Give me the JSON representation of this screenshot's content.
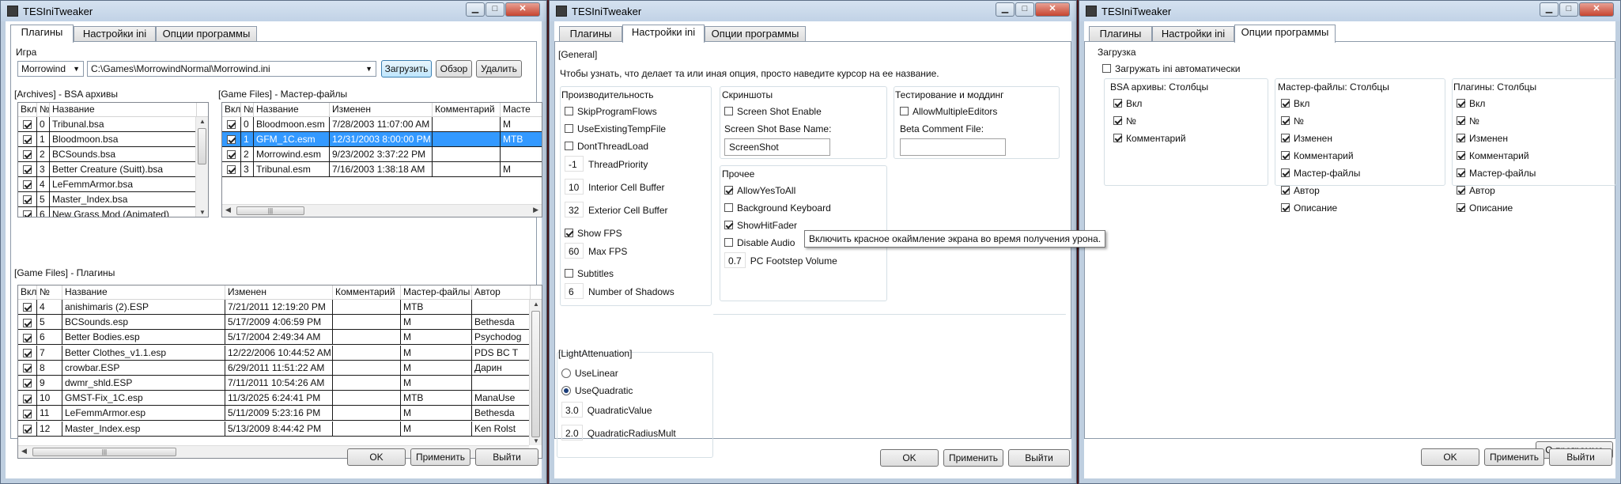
{
  "windows": [
    {
      "title": "TESIniTweaker",
      "tabs": [
        "Плагины",
        "Настройки ini",
        "Опции программы"
      ],
      "active_tab": 0
    },
    {
      "title": "TESIniTweaker",
      "tabs": [
        "Плагины",
        "Настройки ini",
        "Опции программы"
      ],
      "active_tab": 1
    },
    {
      "title": "TESIniTweaker",
      "tabs": [
        "Плагины",
        "Настройки ini",
        "Опции программы"
      ],
      "active_tab": 2
    }
  ],
  "window_buttons": {
    "minimize": "▁",
    "maximize": "□",
    "close": "✕"
  },
  "footer": {
    "ok": "OK",
    "apply": "Применить",
    "exit": "Выйти"
  },
  "plugins": {
    "game_label": "Игра",
    "game_value": "Morrowind",
    "path_value": "C:\\Games\\MorrowindNormal\\Morrowind.ini",
    "load_btn": "Загрузить",
    "browse_btn": "Обзор",
    "delete_btn": "Удалить",
    "bsa_title": "[Archives] - BSA архивы",
    "bsa_headers": [
      "Вкл",
      "№",
      "Название"
    ],
    "bsa_rows": [
      {
        "on": true,
        "n": "0",
        "name": "Tribunal.bsa"
      },
      {
        "on": true,
        "n": "1",
        "name": "Bloodmoon.bsa"
      },
      {
        "on": true,
        "n": "2",
        "name": "BCSounds.bsa"
      },
      {
        "on": true,
        "n": "3",
        "name": "Better Creature (Suitt).bsa"
      },
      {
        "on": true,
        "n": "4",
        "name": "LeFemmArmor.bsa"
      },
      {
        "on": true,
        "n": "5",
        "name": "Master_Index.bsa"
      },
      {
        "on": true,
        "n": "6",
        "name": "New Grass Mod (Animated)"
      }
    ],
    "master_title": "[Game Files] - Мастер-файлы",
    "master_headers": [
      "Вкл",
      "№",
      "Название",
      "Изменен",
      "Комментарий",
      "Масте"
    ],
    "master_rows": [
      {
        "on": true,
        "n": "0",
        "name": "Bloodmoon.esm",
        "date": "7/28/2003 11:07:00 AM",
        "comment": "",
        "master": "M",
        "sel": false
      },
      {
        "on": true,
        "n": "1",
        "name": "GFM_1C.esm",
        "date": "12/31/2003 8:00:00 PM",
        "comment": "",
        "master": "MTB",
        "sel": true
      },
      {
        "on": true,
        "n": "2",
        "name": "Morrowind.esm",
        "date": "9/23/2002 3:37:22 PM",
        "comment": "",
        "master": "",
        "sel": false
      },
      {
        "on": true,
        "n": "3",
        "name": "Tribunal.esm",
        "date": "7/16/2003 1:38:18 AM",
        "comment": "",
        "master": "M",
        "sel": false
      }
    ],
    "plugins_title": "[Game Files] - Плагины",
    "plugins_headers": [
      "Вкл",
      "№",
      "Название",
      "Изменен",
      "Комментарий",
      "Мастер-файлы",
      "Автор"
    ],
    "plugin_rows": [
      {
        "on": true,
        "n": "4",
        "name": "anishimaris (2).ESP",
        "date": "7/21/2011 12:19:20 PM",
        "comment": "",
        "master": "MTB",
        "author": ""
      },
      {
        "on": true,
        "n": "5",
        "name": "BCSounds.esp",
        "date": "5/17/2009 4:06:59 PM",
        "comment": "",
        "master": "M",
        "author": "Bethesda"
      },
      {
        "on": true,
        "n": "6",
        "name": "Better Bodies.esp",
        "date": "5/17/2004 2:49:34 AM",
        "comment": "",
        "master": "M",
        "author": "Psychodog"
      },
      {
        "on": true,
        "n": "7",
        "name": "Better Clothes_v1.1.esp",
        "date": "12/22/2006 10:44:52 AM",
        "comment": "",
        "master": "M",
        "author": "PDS BC T"
      },
      {
        "on": true,
        "n": "8",
        "name": "crowbar.ESP",
        "date": "6/29/2011 11:51:22 AM",
        "comment": "",
        "master": "M",
        "author": "Дарин"
      },
      {
        "on": true,
        "n": "9",
        "name": "dwmr_shld.ESP",
        "date": "7/11/2011 10:54:26 AM",
        "comment": "",
        "master": "M",
        "author": ""
      },
      {
        "on": true,
        "n": "10",
        "name": "GMST-Fix_1C.esp",
        "date": "11/3/2025 6:24:41 PM",
        "comment": "",
        "master": "MTB",
        "author": "ManaUse"
      },
      {
        "on": true,
        "n": "11",
        "name": "LeFemmArmor.esp",
        "date": "5/11/2009 5:23:16 PM",
        "comment": "",
        "master": "M",
        "author": "Bethesda"
      },
      {
        "on": true,
        "n": "12",
        "name": "Master_Index.esp",
        "date": "5/13/2009 8:44:42 PM",
        "comment": "",
        "master": "M",
        "author": "Ken Rolst"
      }
    ]
  },
  "settings": {
    "general_title": "[General]",
    "hint": "Чтобы узнать, что делает та или иная опция, просто наведите курсор на ее название.",
    "perf_title": "Производительность",
    "perf_checks": [
      {
        "on": false,
        "label": "SkipProgramFlows"
      },
      {
        "on": false,
        "label": "UseExistingTempFile"
      },
      {
        "on": false,
        "label": "DontThreadLoad"
      }
    ],
    "thread_priority": {
      "value": "-1",
      "label": "ThreadPriority"
    },
    "interior_buffer": {
      "value": "10",
      "label": "Interior Cell Buffer"
    },
    "exterior_buffer": {
      "value": "32",
      "label": "Exterior Cell Buffer"
    },
    "show_fps": {
      "on": true,
      "label": "Show FPS"
    },
    "max_fps": {
      "value": "60",
      "label": "Max FPS"
    },
    "subtitles": {
      "on": false,
      "label": "Subtitles"
    },
    "shadows": {
      "value": "6",
      "label": "Number of Shadows"
    },
    "screens_title": "Скриншоты",
    "screenshot_enable": {
      "on": false,
      "label": "Screen Shot Enable"
    },
    "screenshot_base_label": "Screen Shot Base Name:",
    "screenshot_base_value": "ScreenShot",
    "testing_title": "Тестирование и моддинг",
    "allow_multiple": {
      "on": false,
      "label": "AllowMultipleEditors"
    },
    "beta_comment_label": "Beta Comment File:",
    "beta_comment_value": "",
    "other_title": "Прочее",
    "other_checks": [
      {
        "on": true,
        "label": "AllowYesToAll"
      },
      {
        "on": false,
        "label": "Background Keyboard"
      },
      {
        "on": true,
        "label": "ShowHitFader"
      },
      {
        "on": false,
        "label": "Disable Audio"
      }
    ],
    "footstep": {
      "value": "0.7",
      "label": "PC Footstep Volume"
    },
    "light_title": "[LightAttenuation]",
    "use_linear": {
      "on": false,
      "label": "UseLinear"
    },
    "use_quadratic": {
      "on": true,
      "label": "UseQuadratic"
    },
    "quad_value": {
      "value": "3.0",
      "label": "QuadraticValue"
    },
    "quad_radius": {
      "value": "2.0",
      "label": "QuadraticRadiusMult"
    },
    "tooltip": "Включить красное окаймление экрана во время получения урона."
  },
  "options": {
    "load_title": "Загрузка",
    "auto_load": {
      "on": false,
      "label": "Загружать ini автоматически"
    },
    "bsa_cols_title": "BSA архивы: Столбцы",
    "bsa_cols": [
      {
        "on": true,
        "label": "Вкл"
      },
      {
        "on": true,
        "label": "№"
      },
      {
        "on": true,
        "label": "Комментарий"
      }
    ],
    "master_cols_title": "Мастер-файлы: Столбцы",
    "master_cols": [
      {
        "on": true,
        "label": "Вкл"
      },
      {
        "on": true,
        "label": "№"
      },
      {
        "on": true,
        "label": "Изменен"
      },
      {
        "on": true,
        "label": "Комментарий"
      },
      {
        "on": true,
        "label": "Мастер-файлы"
      },
      {
        "on": true,
        "label": "Автор"
      },
      {
        "on": true,
        "label": "Описание"
      }
    ],
    "plugin_cols_title": "Плагины: Столбцы",
    "plugin_cols": [
      {
        "on": true,
        "label": "Вкл"
      },
      {
        "on": true,
        "label": "№"
      },
      {
        "on": true,
        "label": "Изменен"
      },
      {
        "on": true,
        "label": "Комментарий"
      },
      {
        "on": true,
        "label": "Мастер-файлы"
      },
      {
        "on": true,
        "label": "Автор"
      },
      {
        "on": true,
        "label": "Описание"
      }
    ],
    "about_btn": "О программе"
  }
}
